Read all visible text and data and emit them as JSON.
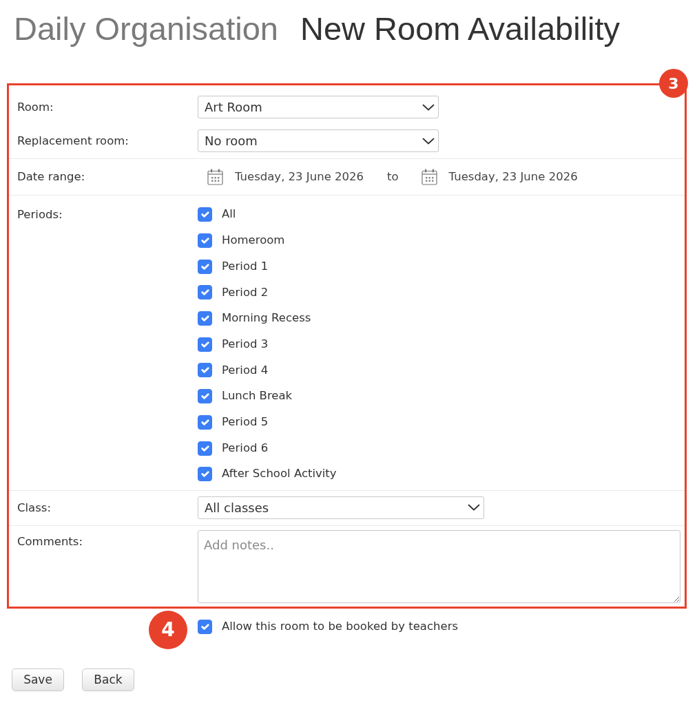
{
  "header": {
    "section": "Daily Organisation",
    "title": "New Room Availability"
  },
  "form": {
    "callout": "3",
    "sections": [
      {
        "fields": [
          {
            "kind": "select",
            "label": "Room:",
            "value": "Art Room"
          },
          {
            "kind": "select",
            "label": "Replacement room:",
            "value": "No room"
          }
        ]
      },
      {
        "fields": [
          {
            "kind": "date_range",
            "label": "Date range:",
            "from": "Tuesday, 23 June 2026",
            "separator": "to",
            "to": "Tuesday, 23 June 2026"
          }
        ]
      },
      {
        "fields": [
          {
            "kind": "checklist",
            "label": "Periods:",
            "options": [
              {
                "label": "All",
                "checked": true
              },
              {
                "label": "Homeroom",
                "checked": true
              },
              {
                "label": "Period 1",
                "checked": true
              },
              {
                "label": "Period 2",
                "checked": true
              },
              {
                "label": "Morning Recess",
                "checked": true
              },
              {
                "label": "Period 3",
                "checked": true
              },
              {
                "label": "Period 4",
                "checked": true
              },
              {
                "label": "Lunch Break",
                "checked": true
              },
              {
                "label": "Period 5",
                "checked": true
              },
              {
                "label": "Period 6",
                "checked": true
              },
              {
                "label": "After School Activity",
                "checked": true
              }
            ]
          }
        ]
      },
      {
        "fields": [
          {
            "kind": "select",
            "label": "Class:",
            "value": "All classes"
          }
        ]
      },
      {
        "fields": [
          {
            "kind": "textarea",
            "label": "Comments:",
            "placeholder": "Add notes.."
          }
        ]
      }
    ]
  },
  "allow_booking": {
    "callout": "4",
    "label": "Allow this room to be booked by teachers",
    "checked": true
  },
  "buttons": [
    "Save",
    "Back"
  ]
}
